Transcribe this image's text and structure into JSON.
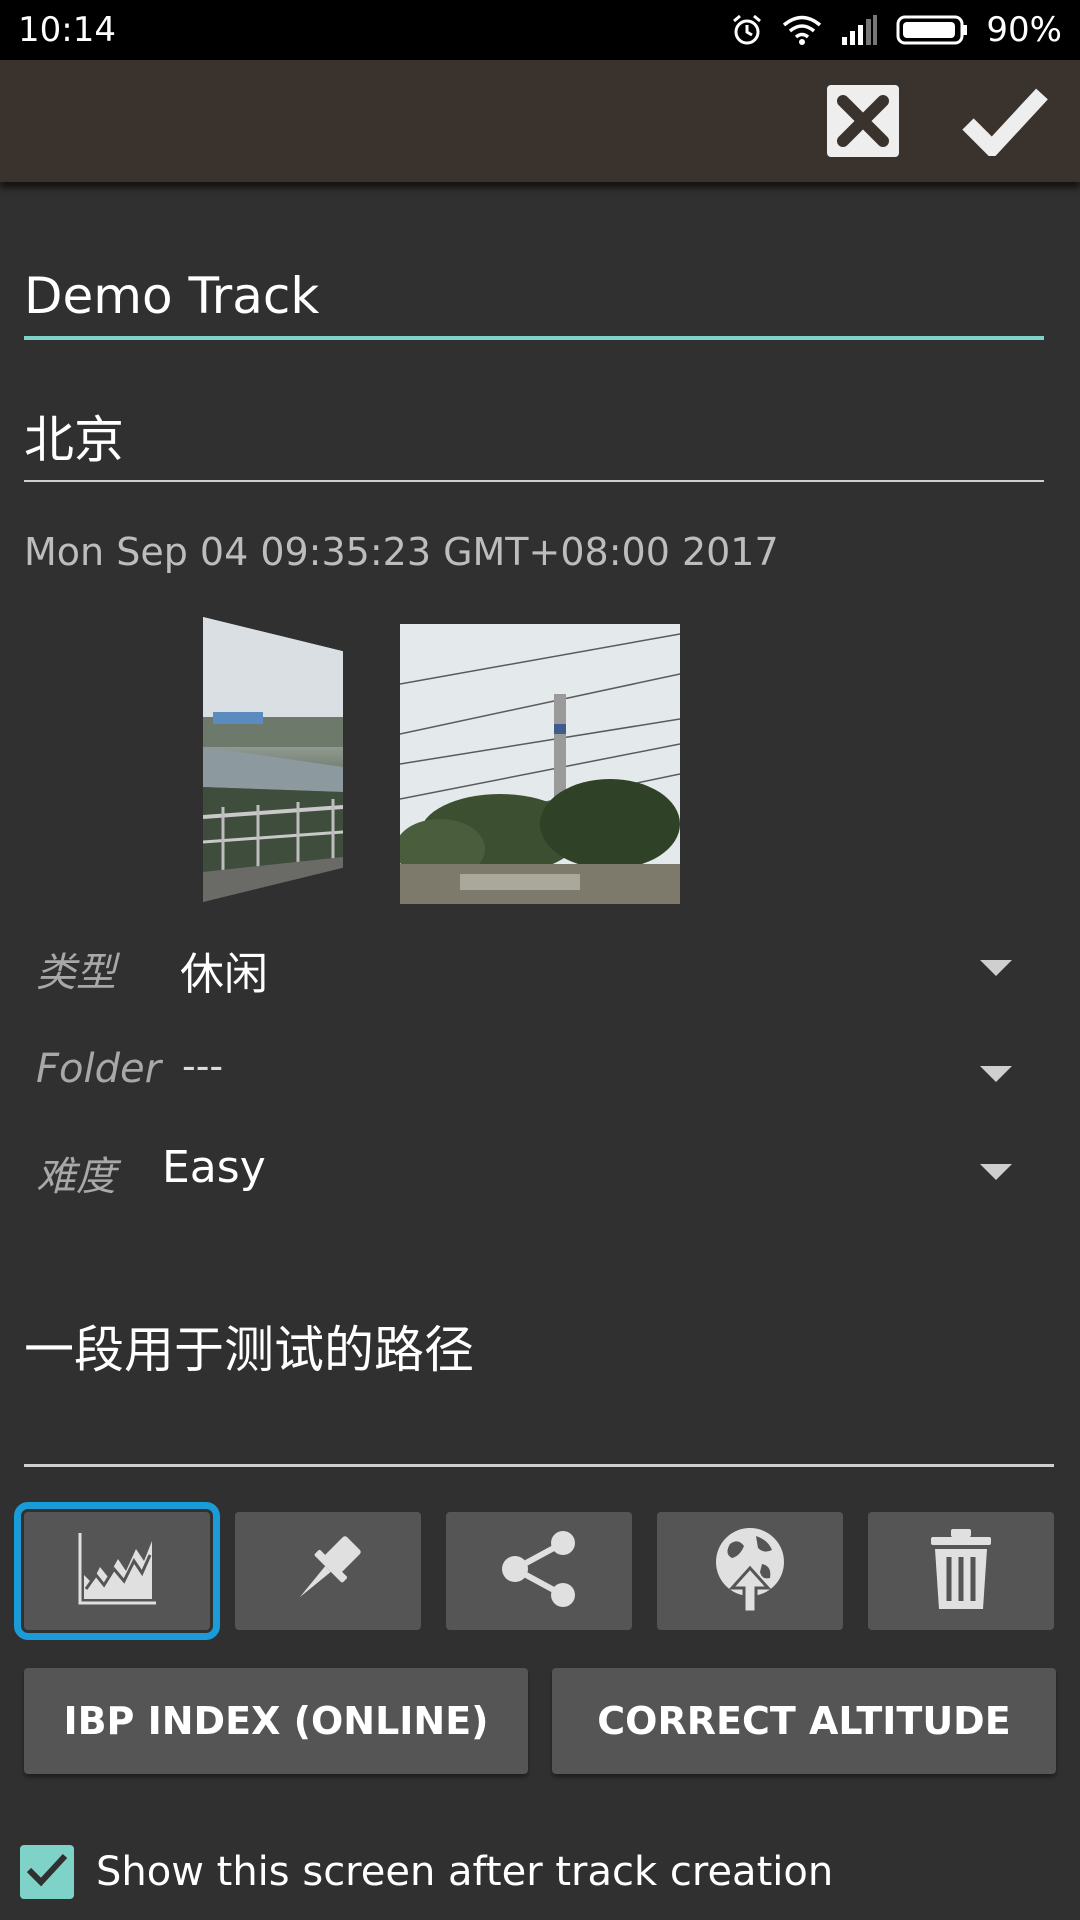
{
  "status_bar": {
    "time": "10:14",
    "battery": "90%",
    "icons": [
      "alarm-icon",
      "wifi-icon",
      "signal-icon",
      "battery-icon"
    ]
  },
  "action_bar": {
    "icons": [
      "close-icon",
      "check-icon"
    ]
  },
  "form": {
    "title": "Demo Track",
    "location": "北京",
    "datetime": "Mon Sep 04 09:35:23 GMT+08:00 2017",
    "type_label": "类型",
    "type_value": "休闲",
    "folder_label": "Folder",
    "folder_value": "---",
    "difficulty_label": "难度",
    "difficulty_value": "Easy",
    "description": "一段用于测试的路径"
  },
  "photos": [
    "bridge-photo",
    "chimney-photo"
  ],
  "tools": [
    {
      "name": "chart-icon",
      "selected": true
    },
    {
      "name": "pushpin-icon",
      "selected": false
    },
    {
      "name": "share-icon",
      "selected": false
    },
    {
      "name": "globe-upload-icon",
      "selected": false
    },
    {
      "name": "trash-icon",
      "selected": false
    }
  ],
  "buttons": {
    "ibp": "IBP INDEX (ONLINE)",
    "correct_altitude": "CORRECT ALTITUDE"
  },
  "checkbox": {
    "label": "Show this screen after track creation",
    "checked": true
  },
  "colors": {
    "accent": "#7fd2c8",
    "selected_outline": "#1a9cd9",
    "background": "#303030",
    "action_bar": "#3a322d"
  }
}
